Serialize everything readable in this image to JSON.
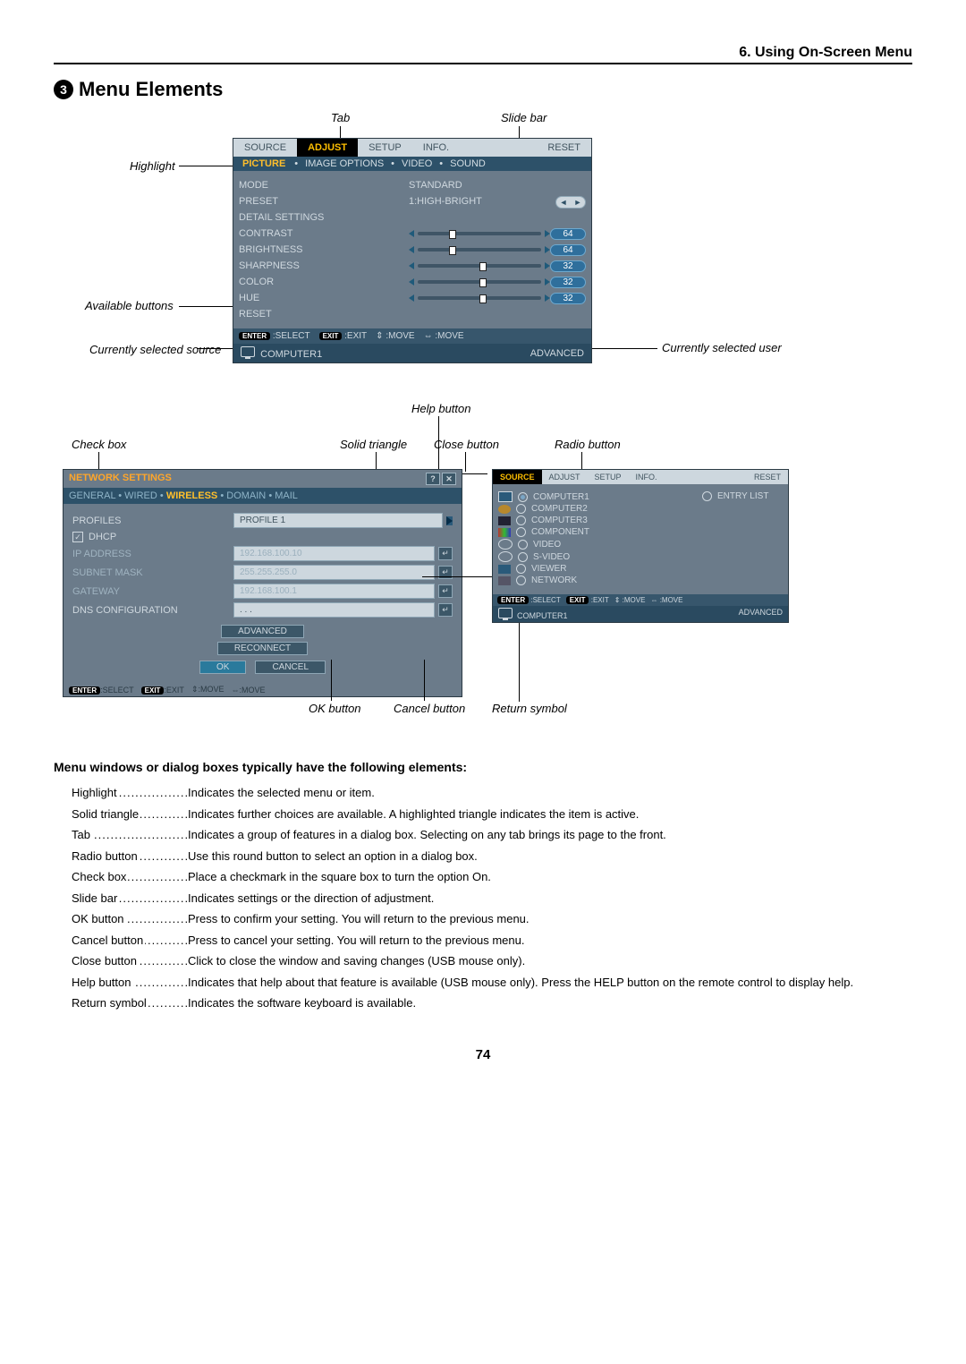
{
  "chapter_header": "6. Using On-Screen Menu",
  "section_number": "3",
  "section_title": "Menu Elements",
  "page_number": "74",
  "main_osd": {
    "tabs": [
      "SOURCE",
      "ADJUST",
      "SETUP",
      "INFO.",
      "RESET"
    ],
    "subtabs_highlight": "PICTURE",
    "subtabs": [
      "IMAGE OPTIONS",
      "VIDEO",
      "SOUND"
    ],
    "rows": {
      "mode_label": "MODE",
      "mode_value": "STANDARD",
      "preset_label": "PRESET",
      "preset_value": "1:HIGH-BRIGHT",
      "detail_label": "DETAIL SETTINGS",
      "contrast_label": "CONTRAST",
      "contrast_value": "64",
      "brightness_label": "BRIGHTNESS",
      "brightness_value": "64",
      "sharpness_label": "SHARPNESS",
      "sharpness_value": "32",
      "color_label": "COLOR",
      "color_value": "32",
      "hue_label": "HUE",
      "hue_value": "32",
      "reset_label": "RESET"
    },
    "footer": {
      "enter_btn": "ENTER",
      "select_hint": ":SELECT",
      "exit_btn": "EXIT",
      "exit_hint": ":EXIT",
      "move_vert": ":MOVE",
      "move_horiz": ":MOVE"
    },
    "source_bar": {
      "source": "COMPUTER1",
      "user": "ADVANCED"
    }
  },
  "network_panel": {
    "title": "NETWORK SETTINGS",
    "tabs": {
      "general": "GENERAL",
      "wired": "WIRED",
      "wireless": "WIRELESS",
      "domain": "DOMAIN",
      "mail": "MAIL"
    },
    "rows": {
      "profiles_label": "PROFILES",
      "profiles_value": "PROFILE 1",
      "dhcp_label": "DHCP",
      "ip_label": "IP ADDRESS",
      "ip_value": "192.168.100.10",
      "subnet_label": "SUBNET MASK",
      "subnet_value": "255.255.255.0",
      "gateway_label": "GATEWAY",
      "gateway_value": "192.168.100.1",
      "dns_label": "DNS CONFIGURATION",
      "dns_value": ". . ."
    },
    "buttons": {
      "advanced": "ADVANCED",
      "reconnect": "RECONNECT",
      "ok": "OK",
      "cancel": "CANCEL"
    },
    "footer": {
      "enter_btn": "ENTER",
      "select_hint": ":SELECT",
      "exit_btn": "EXIT",
      "exit_hint": ":EXIT",
      "move_vert": ":MOVE",
      "move_horiz": ":MOVE"
    }
  },
  "source_panel": {
    "tabs": [
      "SOURCE",
      "ADJUST",
      "SETUP",
      "INFO.",
      "RESET"
    ],
    "entry_list": "ENTRY LIST",
    "sources": [
      "COMPUTER1",
      "COMPUTER2",
      "COMPUTER3",
      "COMPONENT",
      "VIDEO",
      "S-VIDEO",
      "VIEWER",
      "NETWORK"
    ],
    "footer": {
      "enter_btn": "ENTER",
      "select_hint": ":SELECT",
      "exit_btn": "EXIT",
      "exit_hint": ":EXIT",
      "move_vert": ":MOVE",
      "move_horiz": ":MOVE"
    },
    "source_bar": {
      "source": "COMPUTER1",
      "user": "ADVANCED"
    }
  },
  "callouts": {
    "tab": "Tab",
    "slide_bar": "Slide bar",
    "highlight": "Highlight",
    "available_buttons": "Available buttons",
    "currently_selected_source": "Currently selected source",
    "currently_selected_user": "Currently selected user",
    "help_button": "Help button",
    "check_box": "Check box",
    "solid_triangle": "Solid triangle",
    "close_button": "Close button",
    "radio_button": "Radio button",
    "ok_button": "OK button",
    "cancel_button": "Cancel button",
    "return_symbol": "Return symbol"
  },
  "desc_heading": "Menu windows or dialog boxes typically have the following elements:",
  "descriptions": [
    {
      "term": "Highlight",
      "def": "Indicates the selected menu or item."
    },
    {
      "term": "Solid triangle",
      "def": "Indicates further choices are available. A highlighted triangle indicates the item is active."
    },
    {
      "term": "Tab",
      "def": "Indicates a group of features in a dialog box. Selecting on any tab brings its page to the front."
    },
    {
      "term": "Radio button",
      "def": "Use this round button to select an option in a dialog box."
    },
    {
      "term": "Check box",
      "def": "Place a checkmark in the square box to turn the option On."
    },
    {
      "term": "Slide bar",
      "def": "Indicates settings or the direction of adjustment."
    },
    {
      "term": "OK button",
      "def": "Press to confirm your setting. You will return to the previous menu."
    },
    {
      "term": "Cancel button",
      "def": "Press to cancel your setting. You will return to the previous menu."
    },
    {
      "term": "Close button",
      "def": "Click to close the window and saving changes (USB mouse only)."
    },
    {
      "term": "Help button",
      "def": "Indicates that help about that feature is available (USB mouse only). Press the HELP button on the remote control to display help."
    },
    {
      "term": "Return symbol",
      "def": "Indicates the software keyboard is available."
    }
  ]
}
